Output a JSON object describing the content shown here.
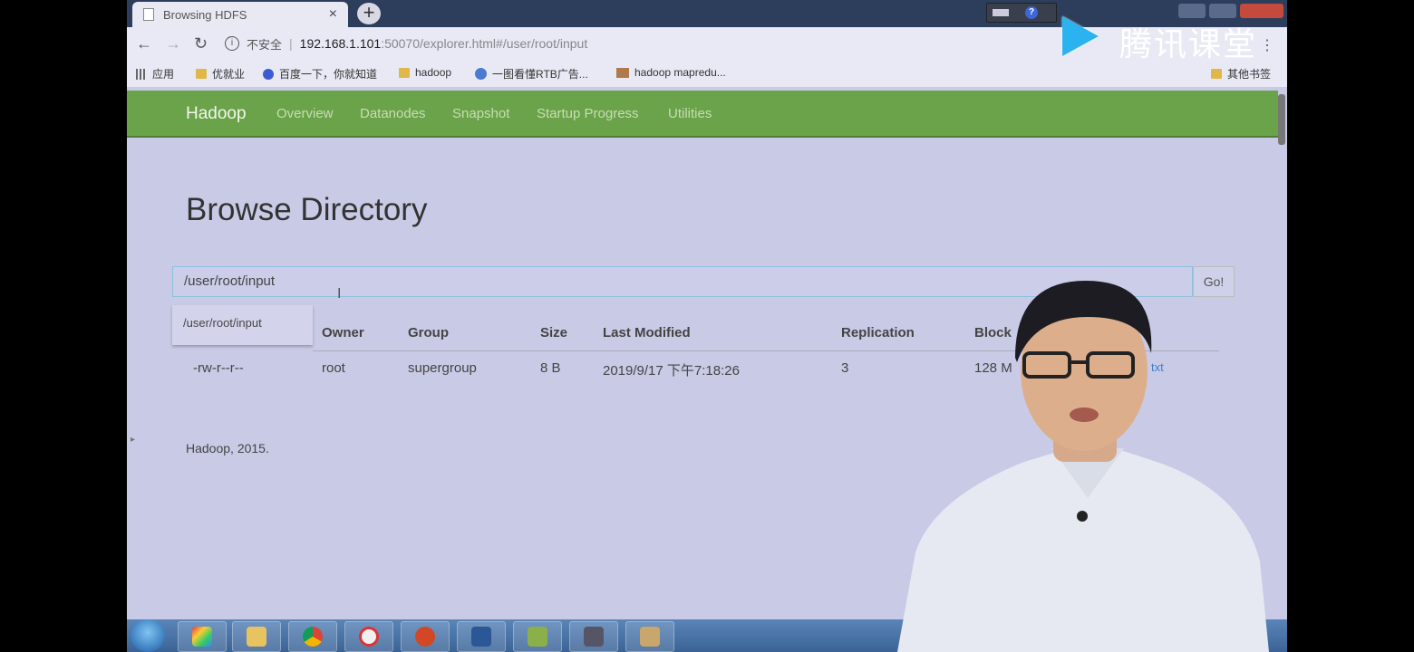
{
  "browser": {
    "tab_title": "Browsing HDFS",
    "tab_close": "×",
    "new_tab": "+",
    "insecure_label": "不安全",
    "url_host": "192.168.1.101",
    "url_rest": ":50070/explorer.html#/user/root/input",
    "bookmarks": [
      {
        "label": "应用",
        "icon": "apps-grid-icon"
      },
      {
        "label": "优就业",
        "icon": "folder-icon"
      },
      {
        "label": "百度一下，你就知道",
        "icon": "baidu-paw-icon"
      },
      {
        "label": "hadoop",
        "icon": "folder-icon"
      },
      {
        "label": "一图看懂RTB广告...",
        "icon": "globe-icon"
      },
      {
        "label": "hadoop mapredu...",
        "icon": "image-icon"
      },
      {
        "label": "其他书签",
        "icon": "folder-icon"
      }
    ]
  },
  "hadoop_nav": {
    "brand": "Hadoop",
    "items": [
      "Overview",
      "Datanodes",
      "Snapshot",
      "Startup Progress",
      "Utilities"
    ]
  },
  "page": {
    "title": "Browse Directory",
    "path_value": "/user/root/input",
    "go_label": "Go!",
    "suggestion": "/user/root/input",
    "columns": [
      "Owner",
      "Group",
      "Size",
      "Last Modified",
      "Replication",
      "Block"
    ],
    "row": {
      "permission": "-rw-r--r--",
      "owner": "root",
      "group": "supergroup",
      "size": "8 B",
      "last_modified": "2019/9/17 下午7:18:26",
      "replication": "3",
      "block": "128 M",
      "name_fragment": "txt"
    },
    "footer": "Hadoop, 2015."
  },
  "watermark": {
    "text": "腾讯课堂",
    "color": "#2bb3f0"
  },
  "colors": {
    "navbar": "#6aa34a",
    "page_bg": "#c9cbe6",
    "link": "#3b7fd3"
  }
}
